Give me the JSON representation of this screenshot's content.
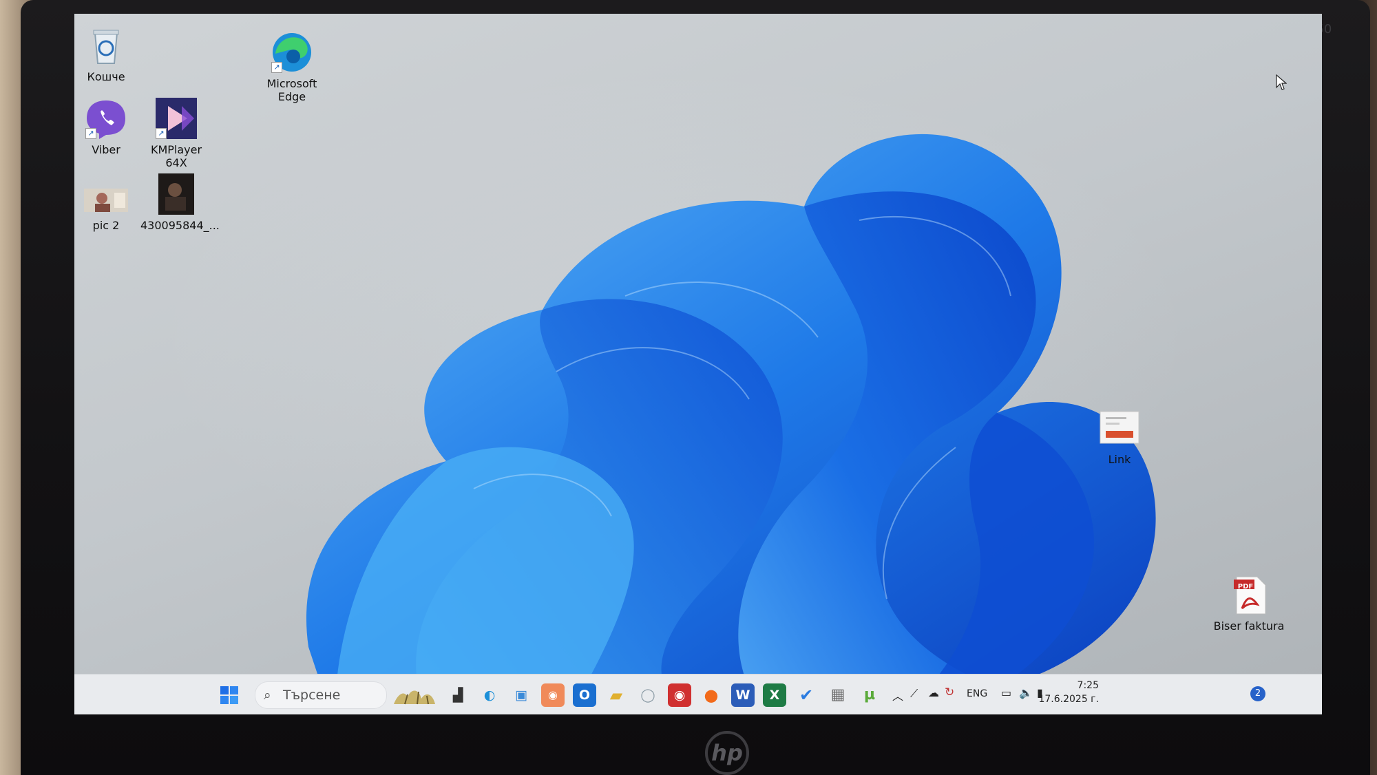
{
  "bezel": {
    "model_label": "850",
    "brand": "hp"
  },
  "desktop_icons": {
    "recycle_bin": "Кошче",
    "edge": [
      "Microsoft",
      "Edge"
    ],
    "viber": "Viber",
    "kmplayer": [
      "KMPlayer",
      "64X"
    ],
    "pic2": "pic 2",
    "video": "430095844_...",
    "link": "Link",
    "pdf": "Biser faktura",
    "pdf_badge": "PDF"
  },
  "taskbar": {
    "search_placeholder": "Търсене",
    "pinned_apps": [
      "file-explorer-icon",
      "edge-icon",
      "photos-icon",
      "snap-icon",
      "outlook-icon",
      "folder-icon",
      "whatsapp-icon",
      "media-icon",
      "firefox-icon",
      "word-icon",
      "excel-icon",
      "todo-icon",
      "calculator-icon",
      "utorrent-icon"
    ],
    "tray": {
      "language": "ENG",
      "time": "7:25",
      "date": "17.6.2025 г.",
      "notification_count": "2"
    }
  },
  "colors": {
    "bloom": "#1f6fe6",
    "taskbar": "#e9ebee",
    "accent": "#2762c9"
  }
}
